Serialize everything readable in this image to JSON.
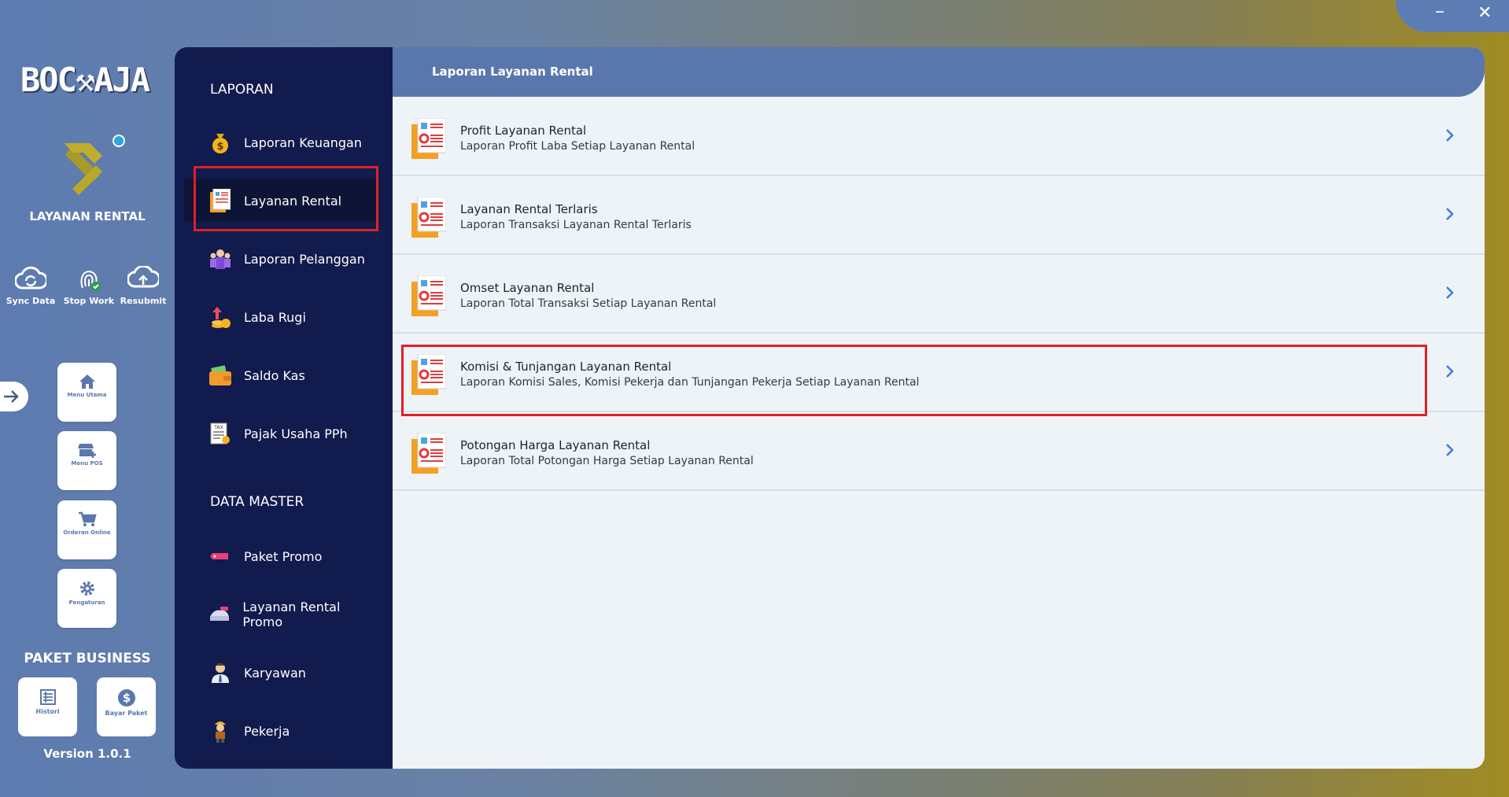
{
  "window": {
    "minimize_label": "–",
    "close_label": "✕"
  },
  "brand": {
    "logo_text": "BOC⚒AJA",
    "app_title": "LAYANAN RENTAL"
  },
  "tools": [
    {
      "label": "Sync Data",
      "icon": "cloud-sync-icon"
    },
    {
      "label": "Stop Work",
      "icon": "fingerprint-check-icon"
    },
    {
      "label": "Resubmit",
      "icon": "cloud-upload-icon"
    }
  ],
  "nav_buttons": [
    {
      "label": "Menu Utama",
      "icon": "home-icon"
    },
    {
      "label": "Menu POS",
      "icon": "store-icon"
    },
    {
      "label": "Orderan Online",
      "icon": "cart-icon"
    },
    {
      "label": "Pengaturan",
      "icon": "gear-icon"
    }
  ],
  "paket": {
    "title": "PAKET BUSINESS",
    "buttons": [
      {
        "label": "Histori",
        "icon": "list-icon"
      },
      {
        "label": "Bayar Paket",
        "icon": "dollar-icon"
      }
    ]
  },
  "version": "Version 1.0.1",
  "menu": {
    "laporan_title": "LAPORAN",
    "laporan_items": [
      {
        "label": "Laporan Keuangan",
        "icon": "money-bag-icon"
      },
      {
        "label": "Layanan Rental",
        "icon": "report-icon",
        "active": true
      },
      {
        "label": "Laporan Pelanggan",
        "icon": "customers-icon"
      },
      {
        "label": "Laba Rugi",
        "icon": "profit-loss-icon"
      },
      {
        "label": "Saldo Kas",
        "icon": "wallet-icon"
      },
      {
        "label": "Pajak Usaha PPh",
        "icon": "tax-icon"
      }
    ],
    "master_title": "DATA MASTER",
    "master_items": [
      {
        "label": "Paket Promo",
        "icon": "promo-tag-icon"
      },
      {
        "label": "Layanan Rental Promo",
        "icon": "rental-promo-icon"
      },
      {
        "label": "Karyawan",
        "icon": "employee-icon"
      },
      {
        "label": "Pekerja",
        "icon": "worker-icon"
      }
    ]
  },
  "content": {
    "header": "Laporan Layanan Rental",
    "reports": [
      {
        "title": "Profit Layanan Rental",
        "subtitle": "Laporan Profit Laba Setiap Layanan Rental"
      },
      {
        "title": "Layanan Rental Terlaris",
        "subtitle": "Laporan Transaksi Layanan Rental Terlaris"
      },
      {
        "title": "Omset Layanan Rental",
        "subtitle": "Laporan Total Transaksi Setiap Layanan Rental"
      },
      {
        "title": "Komisi & Tunjangan Layanan Rental",
        "subtitle": "Laporan Komisi Sales, Komisi Pekerja dan Tunjangan Pekerja Setiap Layanan Rental",
        "highlighted": true
      },
      {
        "title": "Potongan Harga Layanan Rental",
        "subtitle": "Laporan Total Potongan Harga Setiap Layanan Rental"
      }
    ]
  },
  "colors": {
    "accent": "#5a77ad",
    "menu_bg": "#121b4d",
    "highlight": "#e21f26",
    "chevron": "#3d7fd6"
  }
}
